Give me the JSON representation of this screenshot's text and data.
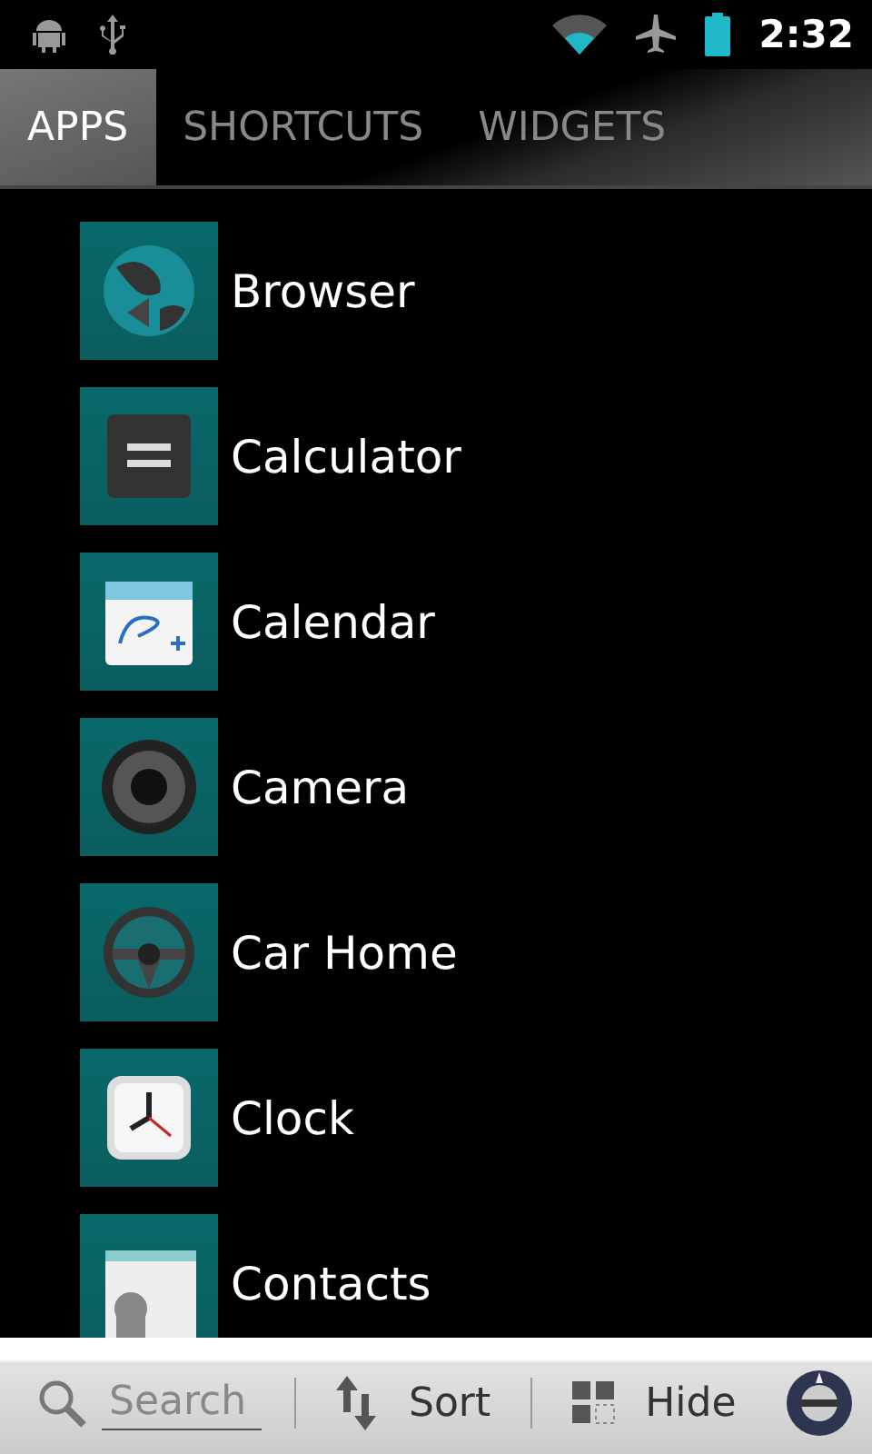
{
  "status_bar": {
    "time": "2:32"
  },
  "tabs": [
    {
      "label": "APPS",
      "selected": true
    },
    {
      "label": "SHORTCUTS",
      "selected": false
    },
    {
      "label": "WIDGETS",
      "selected": false
    }
  ],
  "apps": [
    {
      "name": "Browser",
      "kind": "globe"
    },
    {
      "name": "Calculator",
      "kind": "calculator"
    },
    {
      "name": "Calendar",
      "kind": "calendar"
    },
    {
      "name": "Camera",
      "kind": "camera"
    },
    {
      "name": "Car Home",
      "kind": "wheel"
    },
    {
      "name": "Clock",
      "kind": "clock"
    },
    {
      "name": "Contacts",
      "kind": "contacts"
    }
  ],
  "bottom_bar": {
    "search": {
      "placeholder": "Search"
    },
    "buttons": [
      {
        "label": "Sort",
        "kind": "sort"
      },
      {
        "label": "Hide",
        "kind": "hide"
      }
    ]
  }
}
